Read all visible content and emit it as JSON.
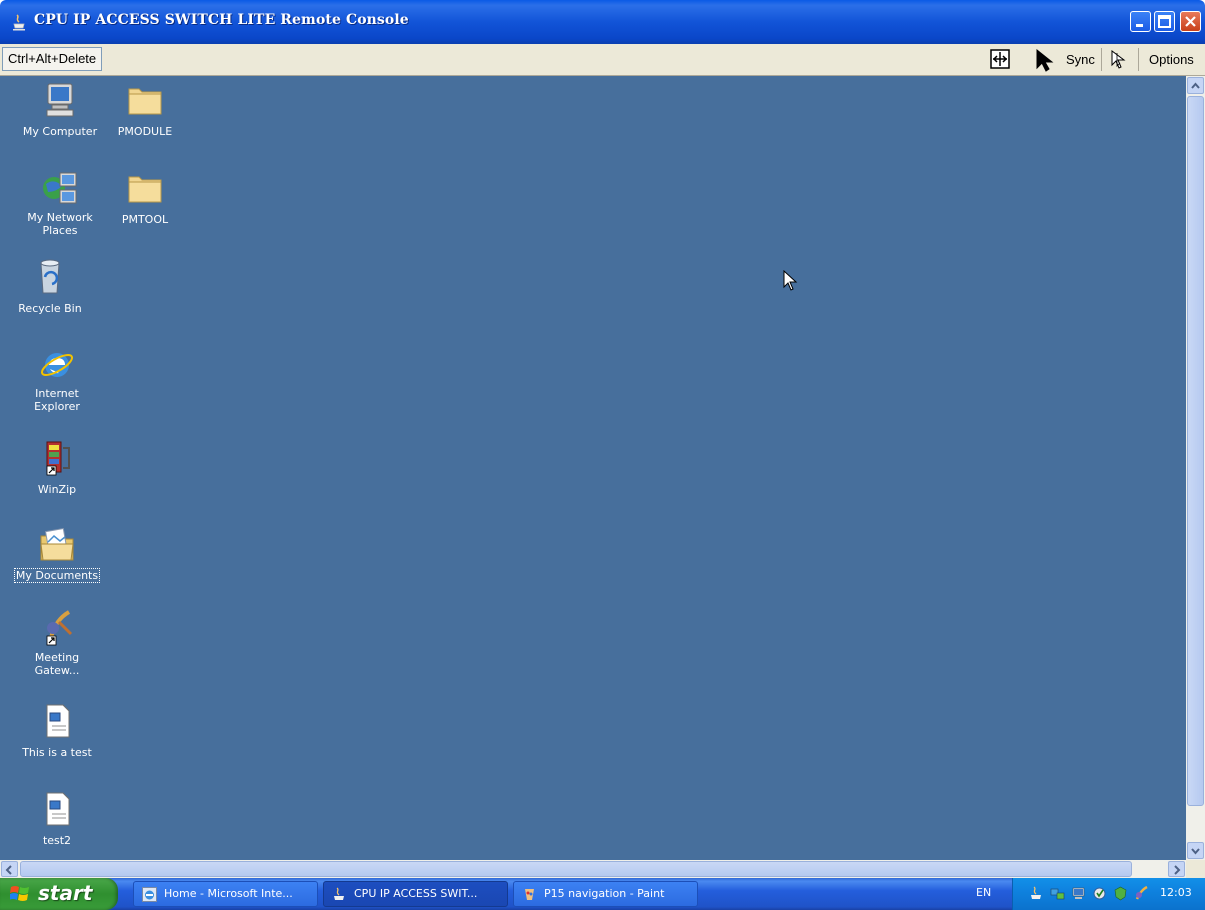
{
  "window": {
    "title": "CPU IP ACCESS SWITCH LITE Remote Console"
  },
  "toolbar": {
    "ctrl_alt_delete": "Ctrl+Alt+Delete",
    "sync": "Sync",
    "options": "Options"
  },
  "desktop": {
    "background_color": "#476f9c",
    "icons": [
      {
        "label": "My Computer",
        "icon": "computer-icon"
      },
      {
        "label": "PMODULE",
        "icon": "folder-icon"
      },
      {
        "label": "My Network Places",
        "icon": "network-icon"
      },
      {
        "label": "PMTOOL",
        "icon": "folder-icon"
      },
      {
        "label": "Recycle Bin",
        "icon": "recycle-bin-icon"
      },
      {
        "label": "Internet Explorer",
        "icon": "internet-explorer-icon"
      },
      {
        "label": "WinZip",
        "icon": "winzip-icon"
      },
      {
        "label": "My Documents",
        "icon": "documents-folder-icon",
        "selected": true
      },
      {
        "label": "Meeting Gatew...",
        "icon": "meeting-gateway-icon"
      },
      {
        "label": "This is a test",
        "icon": "document-icon"
      },
      {
        "label": "test2",
        "icon": "document-icon"
      }
    ]
  },
  "taskbar": {
    "start": "start",
    "tasks": [
      {
        "label": "Home - Microsoft Inte...",
        "icon": "ie-window-icon"
      },
      {
        "label": "CPU IP ACCESS SWIT...",
        "icon": "java-icon",
        "active": true
      },
      {
        "label": "P15 navigation - Paint",
        "icon": "paint-icon"
      }
    ],
    "language": "EN",
    "clock": "12:03"
  }
}
